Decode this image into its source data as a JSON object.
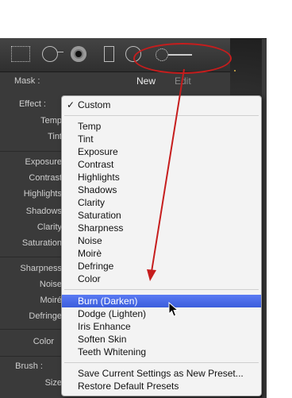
{
  "mask": {
    "label": "Mask :",
    "new_label": "New",
    "edit_label": "Edit"
  },
  "panel": {
    "effect_label": "Effect :",
    "labels": [
      "Temp",
      "Tint",
      "Exposure",
      "Contrast",
      "Highlights",
      "Shadows",
      "Clarity",
      "Saturation",
      "Sharpness",
      "Noise",
      "Moiré",
      "Defringe",
      "Color",
      "Brush :",
      "Size"
    ]
  },
  "menu": {
    "checkmark": "✓",
    "groups": [
      [
        "Custom"
      ],
      [
        "Temp",
        "Tint",
        "Exposure",
        "Contrast",
        "Highlights",
        "Shadows",
        "Clarity",
        "Saturation",
        "Sharpness",
        "Noise",
        "Moirè",
        "Defringe",
        "Color"
      ],
      [
        "Burn (Darken)",
        "Dodge (Lighten)",
        "Iris Enhance",
        "Soften Skin",
        "Teeth Whitening"
      ],
      [
        "Save Current Settings as New Preset...",
        "Restore Default Presets"
      ]
    ],
    "highlighted": "Burn (Darken)"
  },
  "colors": {
    "annotation_red": "#c61d1d",
    "menu_highlight": "#3b5ddc",
    "panel_bg": "#3a3a3a"
  },
  "icons": [
    "marquee-tool-icon",
    "graduated-filter-icon",
    "radial-filter-icon",
    "spot-removal-icon",
    "red-eye-icon",
    "adjustment-brush-icon",
    "pointer-cursor-icon"
  ]
}
